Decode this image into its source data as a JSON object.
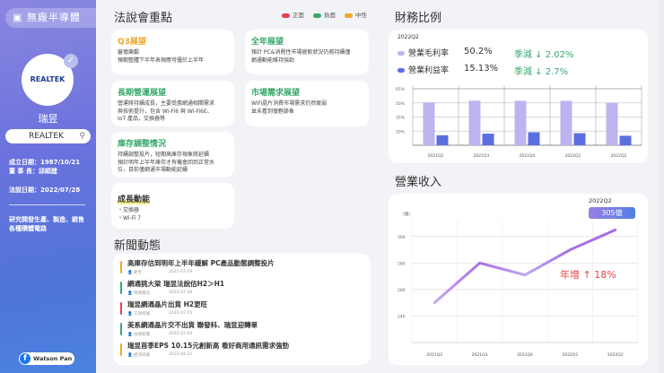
{
  "sidebar": {
    "category": "無廠半導體",
    "logo_text": "REALTEK",
    "company_name": "瑞昱",
    "search_value": "REALTEK",
    "founded": "成立日期：1987/10/21",
    "chairman": "董 事 長：邱順建",
    "conference_date": "法說日期：2022/07/28",
    "description": "研究開發生產、製造、銷售各種積體電路",
    "author": "Watson Pan"
  },
  "highlights": {
    "title": "法說會重點",
    "legend": [
      {
        "label": "正面",
        "color": "#e8414a"
      },
      {
        "label": "負面",
        "color": "#3aa86b"
      },
      {
        "label": "中性",
        "color": "#f5a623"
      }
    ],
    "cards": [
      {
        "title": "Q3展望",
        "body": "審慎樂觀\n預期整體下半年表現應可優於上半年",
        "color": "#f5a623"
      },
      {
        "title": "全年展望",
        "body": "預計 PC&消費性市場疲軟狀況仍將持續僅\n網通動能維持強勁",
        "color": "#3aa86b"
      },
      {
        "title": "長期營運展望",
        "body": "營運將持續成長，主要受惠網通相關需求\n與技術提升，包含 Wi-Fi6 與 Wi-Fi6E、\nIoT 產品，交換器等",
        "color": "#3aa86b"
      },
      {
        "title": "市場需求展望",
        "body": "WiFi晶片消費市場需求仍然疲弱\n並未看到復甦跡象",
        "color": "#3aa86b"
      },
      {
        "title": "庫存調整情況",
        "body": "持續調整投片，短期高庫存現象將延續\n預計明年上半年庫存才有機會回到正常水\n位，目前僅網通市場動能延續",
        "color": "#3aa86b"
      },
      {
        "title": "成長動能",
        "body": "・交換器\n・Wi-Fi 7",
        "color": "#333333"
      }
    ]
  },
  "news": {
    "title": "新聞動態",
    "items": [
      {
        "headline": "高庫存估到明年上半年緩解 PC產品動態調整投片",
        "source": "鉅亨",
        "date": "2022-07-29",
        "color": "#f5a623"
      },
      {
        "headline": "網通挑大梁 瑞昱法說估H2＞H1",
        "source": "時報資訊",
        "date": "2022-07-28",
        "color": "#3aa86b"
      },
      {
        "headline": "瑞昱網通晶片出貨 H2更旺",
        "source": "工商時報",
        "date": "2022-07-15",
        "color": "#e8414a"
      },
      {
        "headline": "美系網通晶片交不出貨 聯發科、瑞昱迎轉單",
        "source": "台視新聞",
        "date": "2022-07-04",
        "color": "#3aa86b"
      },
      {
        "headline": "瑞昱首季EPS 10.15元創新高 看好商用通訊需求強勁",
        "source": "經濟日報",
        "date": "2022-04-22",
        "color": "#f5a623"
      }
    ]
  },
  "ratios": {
    "title": "財務比例",
    "period": "2022Q2",
    "rows": [
      {
        "label": "營業毛利率",
        "value": "50.2%",
        "change": "季減 ↓ 2.02%",
        "color": "#bdb4ef"
      },
      {
        "label": "營業利益率",
        "value": "15.13%",
        "change": "季減 ↓ 2.7%",
        "color": "#5b6fe0"
      }
    ]
  },
  "revenue": {
    "title": "營業收入",
    "badge_period": "2022Q2",
    "badge_value": "305億",
    "unit": "(億)",
    "yoy": "年增 ↑ 18%"
  },
  "chart_data": [
    {
      "type": "bar",
      "categories": [
        "2021Q2",
        "2021Q3",
        "2021Q4",
        "2022Q1",
        "2022Q2"
      ],
      "series": [
        {
          "name": "營業毛利率",
          "values": [
            50.5,
            52.4,
            52.2,
            52.2,
            50.2
          ]
        },
        {
          "name": "營業利益率",
          "values": [
            15.6,
            17.3,
            18.8,
            17.8,
            15.13
          ]
        }
      ],
      "yticks": [
        "20%",
        "35%",
        "50%",
        "65%"
      ],
      "ylim": [
        5,
        65
      ]
    },
    {
      "type": "line",
      "categories": [
        "2021Q2",
        "2021Q3",
        "2021Q4",
        "2022Q1",
        "2022Q2"
      ],
      "series": [
        {
          "name": "營業收入",
          "values": [
            250,
            280,
            271,
            290,
            305
          ]
        }
      ],
      "yticks": [
        "240",
        "260",
        "280",
        "300"
      ],
      "ylim": [
        220,
        310
      ],
      "ylabel": "(億)"
    }
  ]
}
